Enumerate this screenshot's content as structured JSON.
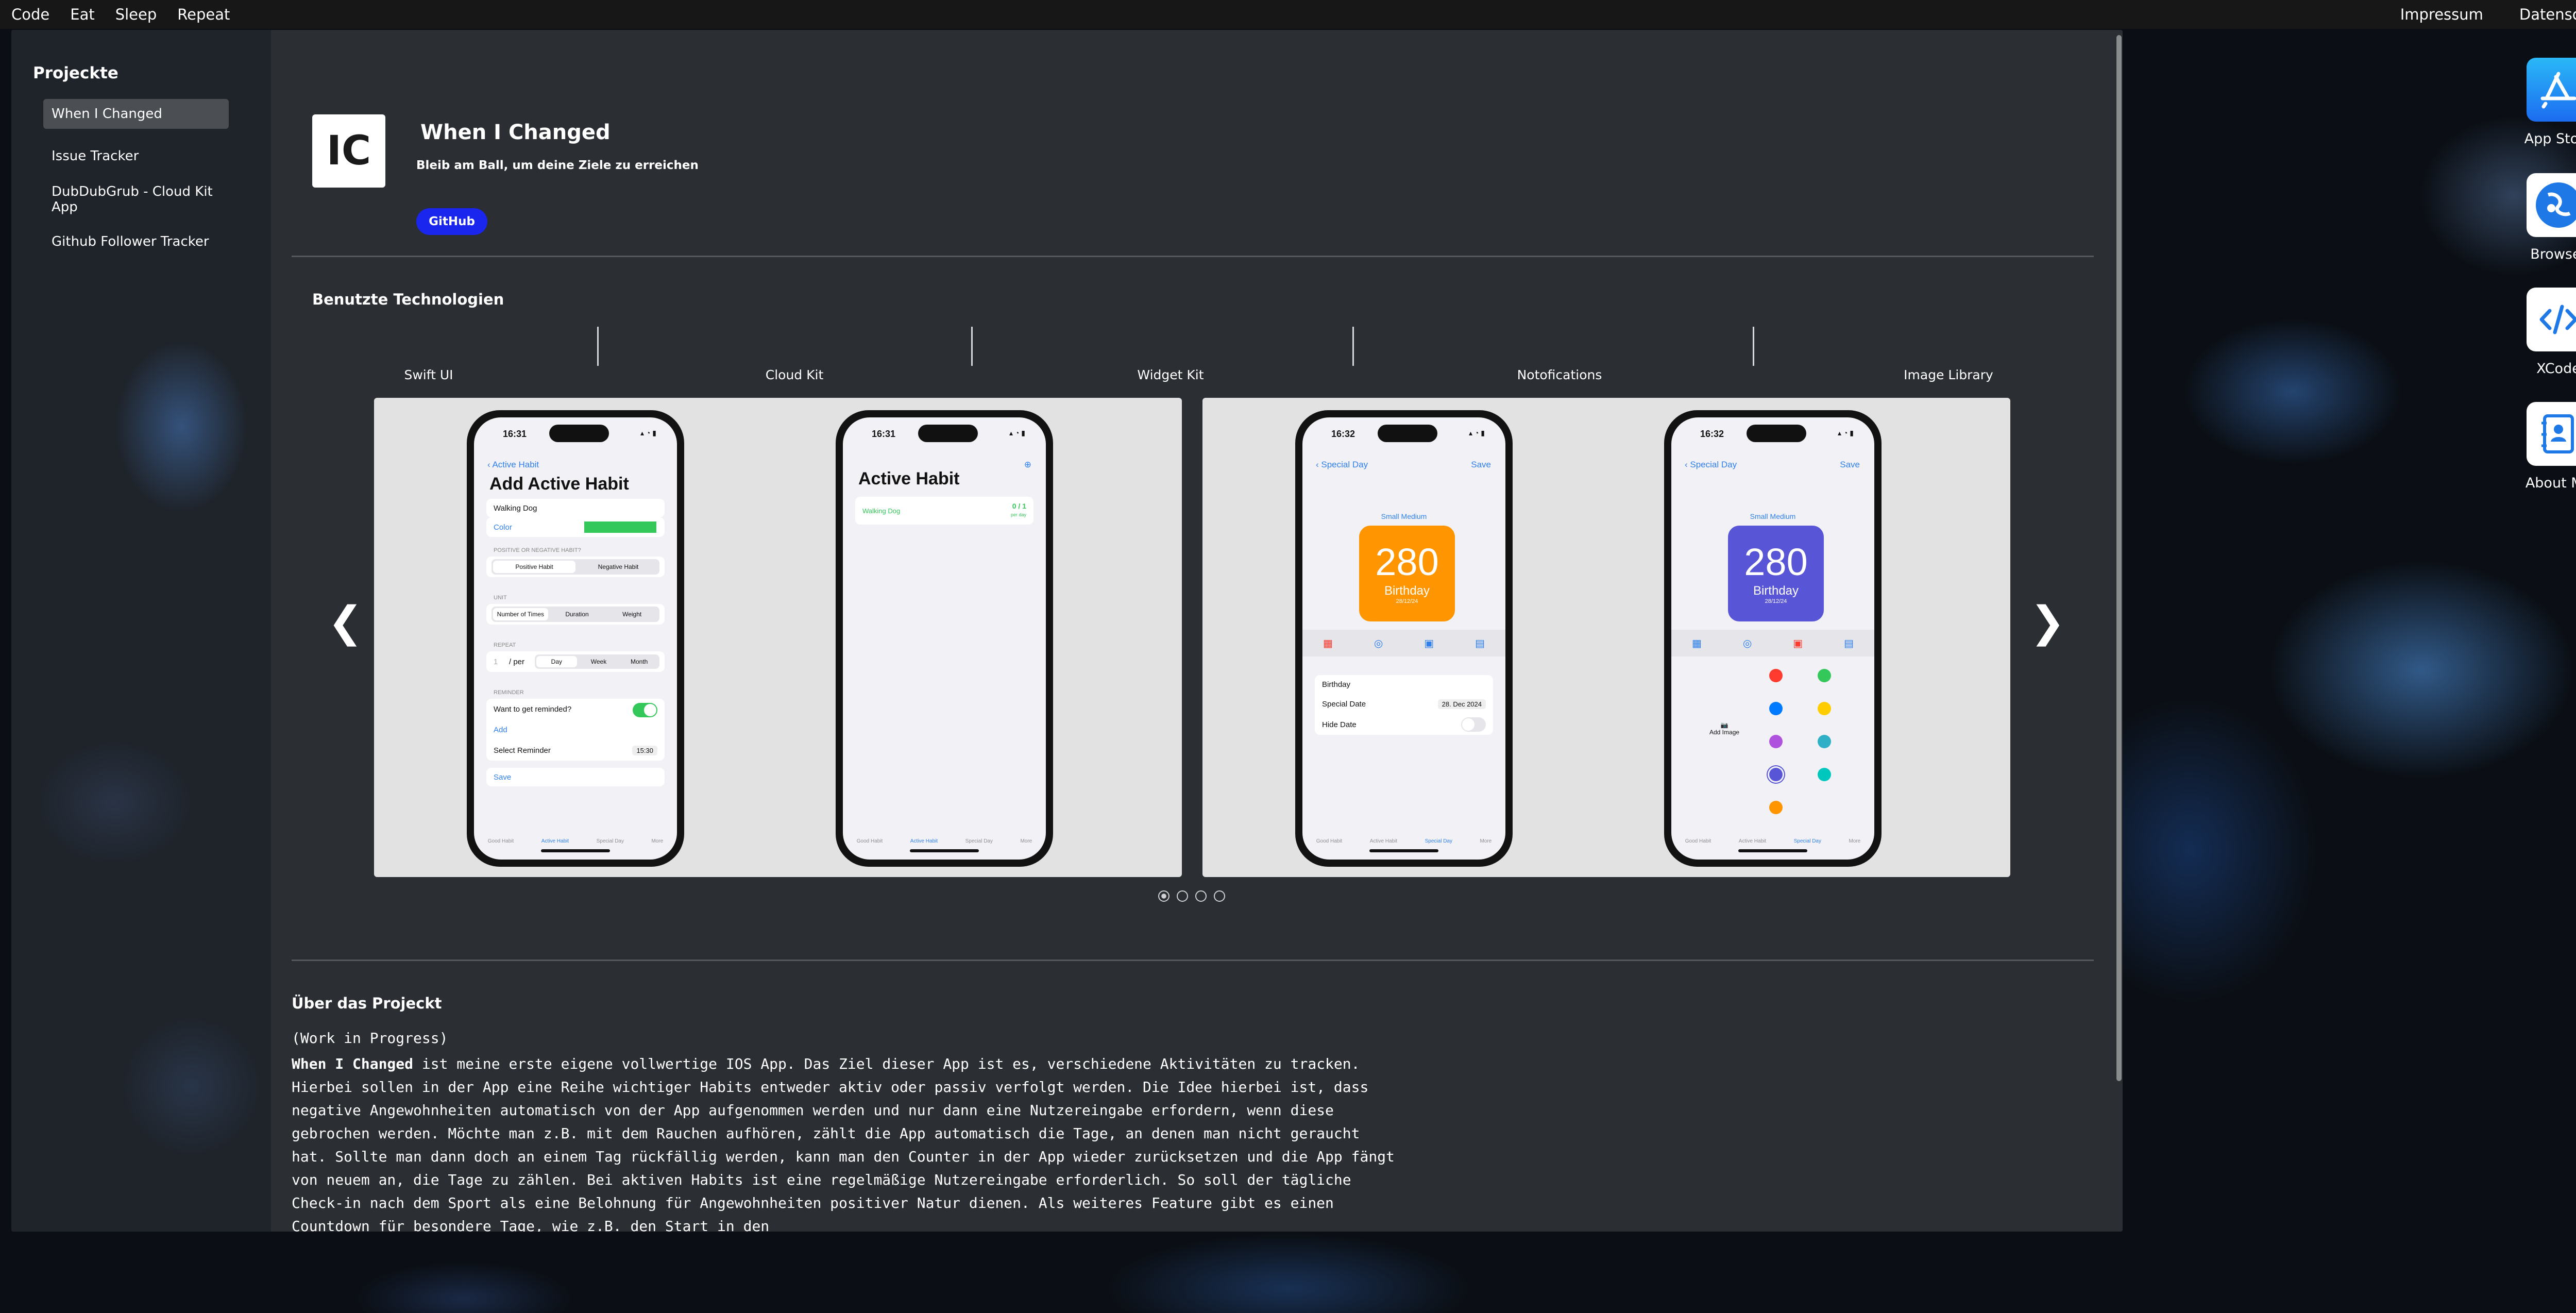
{
  "menubar": {
    "left": [
      "Code",
      "Eat",
      "Sleep",
      "Repeat"
    ],
    "right": [
      "Impressum",
      "Datenschutz"
    ]
  },
  "sidebar": {
    "title": "Projeckte",
    "items": [
      {
        "label": "When I Changed"
      },
      {
        "label": "Issue Tracker"
      },
      {
        "label": "DubDubGrub - Cloud Kit App"
      },
      {
        "label": "Github Follower Tracker"
      }
    ]
  },
  "project": {
    "logo": "IC",
    "title": "When I Changed",
    "subtitle": "Bleib am Ball, um deine Ziele zu erreichen",
    "github_label": "GitHub"
  },
  "technologies": {
    "title": "Benutzte Technologien",
    "items": [
      "Swift UI",
      "Cloud Kit",
      "Widget Kit",
      "Notofications",
      "Image Library"
    ]
  },
  "carousel": {
    "prev": "❮",
    "next": "❯",
    "dots": 4,
    "active_dot": 1,
    "phone1": {
      "time": "16:31",
      "back": "Active Habit",
      "title": "Add Active Habit",
      "name_value": "Walking Dog",
      "color_label": "Color",
      "color": "#34c759",
      "section_positive": "POSITIVE OR NEGATIVE HABIT?",
      "positive": "Positive Habit",
      "negative": "Negative Habit",
      "section_unit": "UNIT",
      "unit_options": [
        "Number of Times",
        "Duration",
        "Weight"
      ],
      "section_repeat": "REPEAT",
      "repeat_value": "1",
      "repeat_per": "/ per",
      "repeat_options": [
        "Day",
        "Week",
        "Month"
      ],
      "section_reminder": "REMINDER",
      "reminder_question": "Want to get reminded?",
      "add": "Add",
      "select_reminder": "Select Reminder",
      "reminder_time": "15:30",
      "save": "Save",
      "tabs": [
        "Good Habit",
        "Active Habit",
        "Special Day",
        "More"
      ]
    },
    "phone2": {
      "time": "16:31",
      "title": "Active Habit",
      "item_name": "Walking Dog",
      "item_count": "0 / 1",
      "item_sub": "per day",
      "tabs": [
        "Good Habit",
        "Active Habit",
        "Special Day",
        "More"
      ]
    },
    "phone3": {
      "time": "16:32",
      "back": "Special Day",
      "save": "Save",
      "size_label": "Small  Medium",
      "number": "280",
      "label": "Birthday",
      "date_small": "28/12/24",
      "card_color": "#ff9500",
      "name_value": "Birthday",
      "special_date_label": "Special Date",
      "special_date_value": "28. Dec 2024",
      "hide_date": "Hide Date",
      "tabs": [
        "Good Habit",
        "Active Habit",
        "Special Day",
        "More"
      ]
    },
    "phone4": {
      "time": "16:32",
      "back": "Special Day",
      "save": "Save",
      "size_label": "Small  Medium",
      "number": "280",
      "label": "Birthday",
      "date_small": "28/12/24",
      "card_color": "#5856d6",
      "add_image": "Add Image",
      "colors": [
        "#ff3b30",
        "#34c759",
        "#007aff",
        "#ffcc00",
        "#af52de",
        "#30b0c7",
        "#5856d6",
        "#00c7be",
        "#ff9500"
      ],
      "tabs": [
        "Good Habit",
        "Active Habit",
        "Special Day",
        "More"
      ]
    }
  },
  "about": {
    "title": "Über das Projeckt",
    "wip": "(Work in Progress)",
    "lead": "When I Changed",
    "text": " ist meine erste eigene vollwertige IOS App. Das Ziel dieser App ist es, verschiedene Aktivitäten zu tracken. Hierbei sollen in der App eine Reihe wichtiger Habits entweder aktiv oder passiv verfolgt werden. Die Idee hierbei ist, dass negative Angewohnheiten automatisch von der App aufgenommen werden und nur dann eine Nutzereingabe erfordern, wenn diese gebrochen werden. Möchte man z.B. mit dem Rauchen aufhören, zählt die App automatisch die Tage, an denen man nicht geraucht hat. Sollte man dann doch an einem Tag rückfällig werden, kann man den Counter in der App wieder zurücksetzen und die App fängt von neuem an, die Tage zu zählen. Bei aktiven Habits ist eine regelmäßige Nutzereingabe erforderlich. So soll der tägliche Check-in nach dem Sport als eine Belohnung für Angewohnheiten positiver Natur dienen. Als weiteres Feature gibt es einen Countdown für besondere Tage, wie z.B. den Start in den"
  },
  "dock": [
    {
      "label": "App Store",
      "icon": "app-store-icon"
    },
    {
      "label": "Browser",
      "icon": "browser-icon"
    },
    {
      "label": "XCode",
      "icon": "xcode-icon"
    },
    {
      "label": "About Me",
      "icon": "about-me-icon"
    }
  ]
}
